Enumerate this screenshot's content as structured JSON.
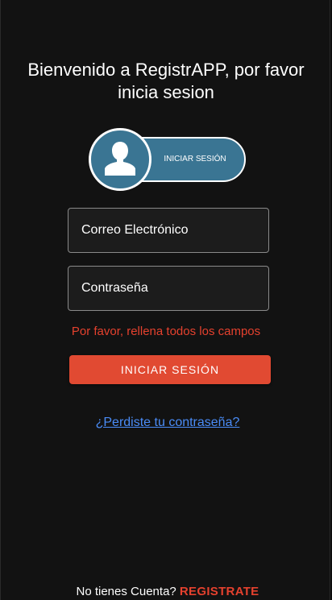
{
  "header": {
    "title": "Bienvenido a RegistrAPP, por favor inicia sesion"
  },
  "login_badge": {
    "label": "INICIAR SESIÓN",
    "icon": "user-icon"
  },
  "form": {
    "email_placeholder": "Correo Electrónico",
    "password_placeholder": "Contraseña",
    "error_message": "Por favor, rellena todos los campos",
    "submit_label": "INICIAR SESIÓN"
  },
  "links": {
    "forgot_password": "¿Perdiste tu contraseña?"
  },
  "footer": {
    "prompt": "No tienes Cuenta?",
    "register_label": "REGISTRATE"
  },
  "colors": {
    "background": "#121212",
    "accent_blue": "#3a7593",
    "primary_button": "#e14a32",
    "error": "#e5412e",
    "link": "#4a8cf7"
  }
}
